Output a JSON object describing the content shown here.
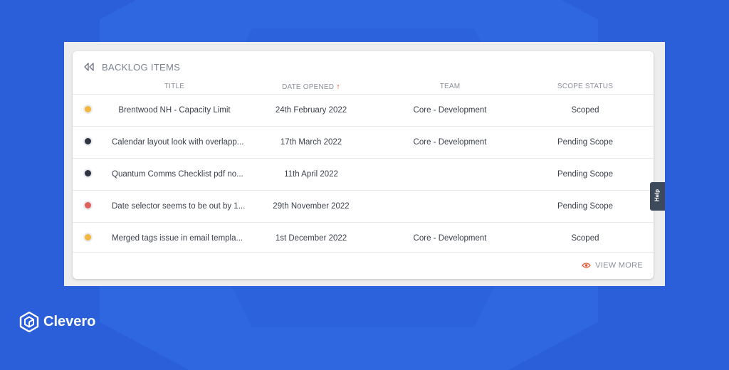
{
  "panel": {
    "title": "BACKLOG ITEMS",
    "columns": {
      "title": "TITLE",
      "date_opened": "DATE OPENED",
      "team": "TEAM",
      "scope_status": "SCOPE STATUS"
    },
    "sort_arrow": "↑",
    "rows": [
      {
        "dot_color": "#f4b73d",
        "title": "Brentwood NH - Capacity Limit",
        "date": "24th February 2022",
        "team": "Core - Development",
        "scope": "Scoped"
      },
      {
        "dot_color": "#2e3442",
        "title": "Calendar layout look with overlapp...",
        "date": "17th March 2022",
        "team": "Core - Development",
        "scope": "Pending Scope"
      },
      {
        "dot_color": "#2e3442",
        "title": "Quantum Comms Checklist pdf no...",
        "date": "11th April 2022",
        "team": "",
        "scope": "Pending Scope"
      },
      {
        "dot_color": "#e0625e",
        "title": "Date selector seems to be out by 1...",
        "date": "29th November 2022",
        "team": "",
        "scope": "Pending Scope"
      },
      {
        "dot_color": "#f4b73d",
        "title": "Merged tags issue in email templa...",
        "date": "1st December 2022",
        "team": "Core - Development",
        "scope": "Scoped"
      }
    ],
    "view_more": "VIEW MORE"
  },
  "help_tab": "Help",
  "brand": {
    "name": "Clevero"
  },
  "icons": {
    "collapse": "double-chevron-left-icon",
    "eye": "eye-icon",
    "logo": "clevero-logo-icon"
  },
  "colors": {
    "background": "#2a5fd9",
    "accent": "#e0522c"
  }
}
